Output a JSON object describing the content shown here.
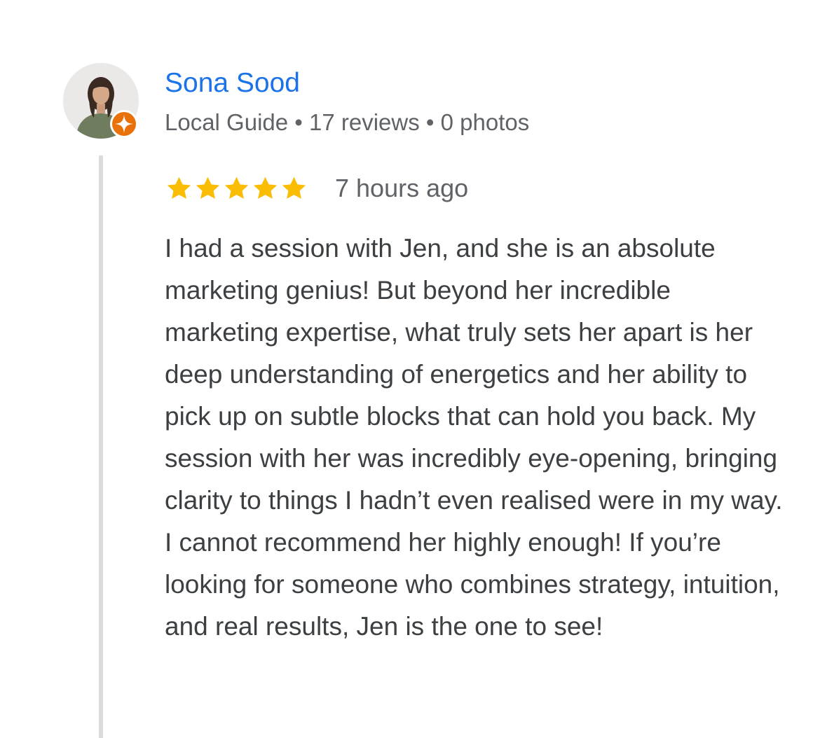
{
  "reviewer": {
    "name": "Sona Sood",
    "meta": "Local Guide • 17 reviews • 0 photos",
    "avatar_icon": "profile-photo",
    "badge_icon": "local-guide-star-icon"
  },
  "review": {
    "rating": 5,
    "rating_max": 5,
    "time": "7 hours ago",
    "text": "I had a session with Jen, and she is an absolute marketing genius! But beyond her incredible marketing expertise, what truly sets her apart is her deep understanding of energetics and her ability to pick up on subtle blocks that can hold you back. My session with her was incredibly eye-opening, bringing clarity to things I hadn’t even realised were in my way. I cannot recommend her highly enough! If you’re looking for someone who combines strategy, intuition, and real results, Jen is the one to see!"
  },
  "colors": {
    "name_link": "#1a73e8",
    "meta_text": "#5f6368",
    "body_text": "#3c4043",
    "star": "#fbbc04",
    "badge": "#e8710a",
    "thread_line": "#dadce0"
  }
}
